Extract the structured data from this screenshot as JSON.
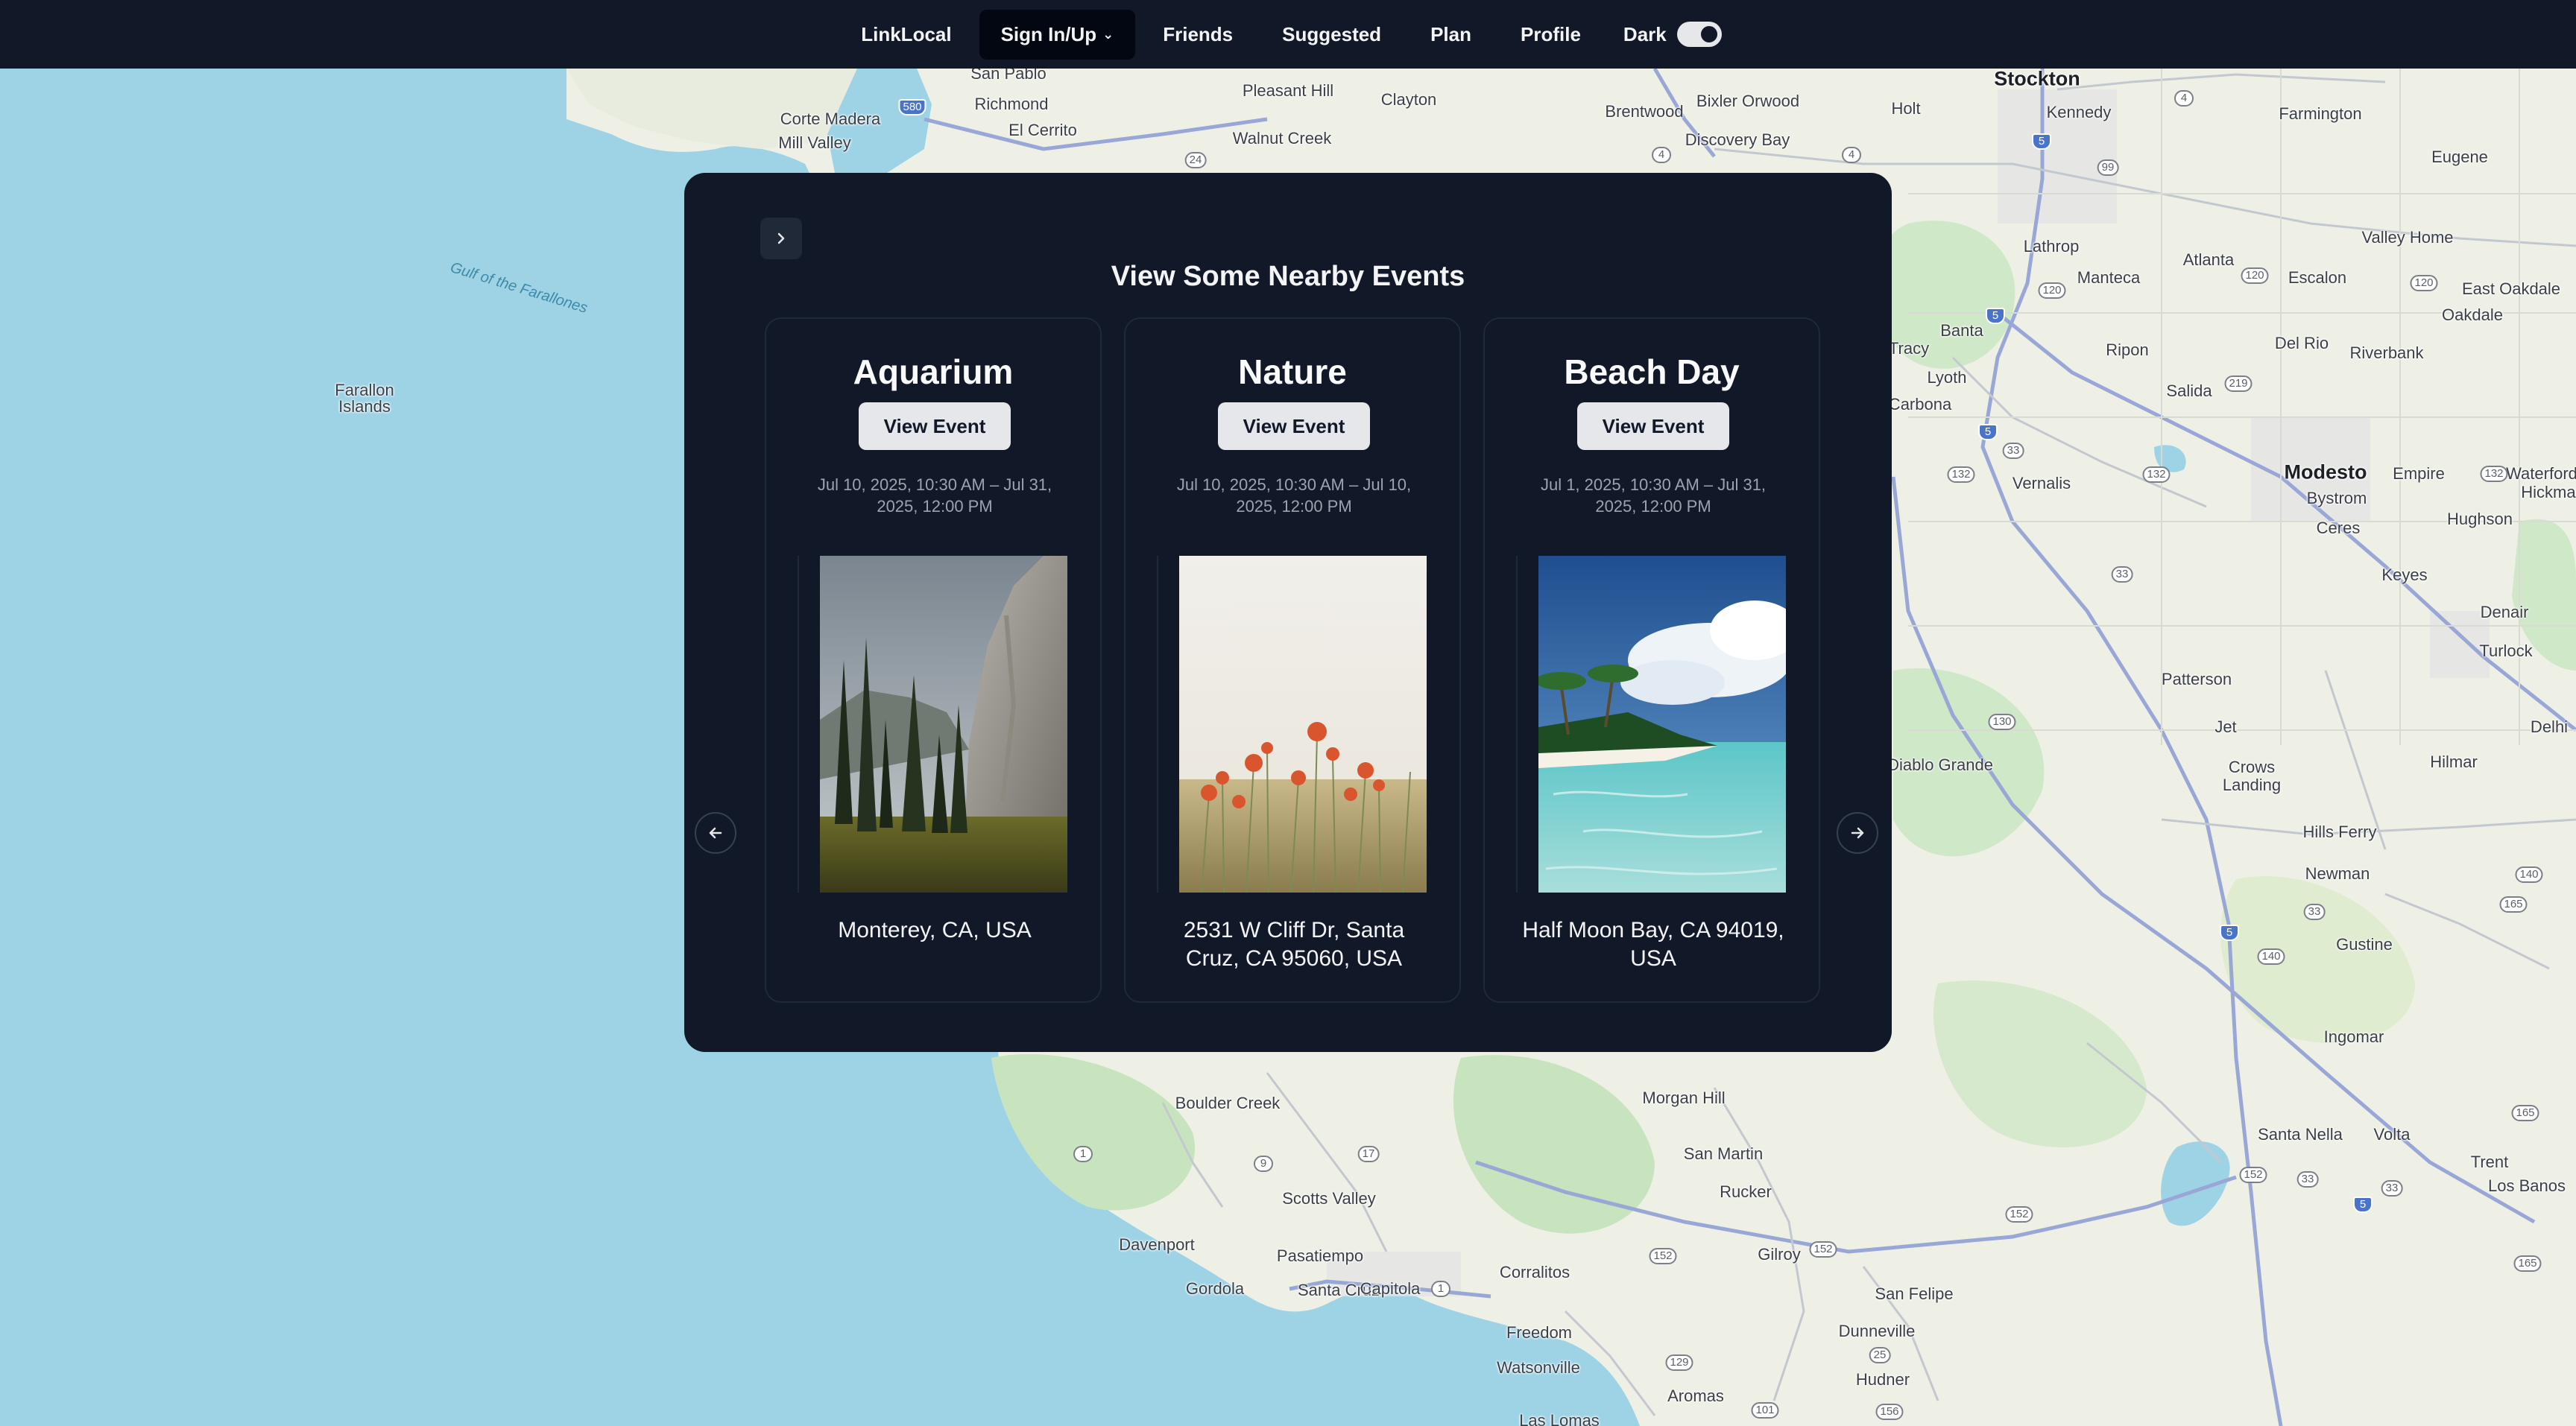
{
  "nav": {
    "items": [
      {
        "label": "LinkLocal",
        "active": false
      },
      {
        "label": "Sign In/Up",
        "active": true,
        "dropdown": true
      },
      {
        "label": "Friends",
        "active": false
      },
      {
        "label": "Suggested",
        "active": false
      },
      {
        "label": "Plan",
        "active": false
      },
      {
        "label": "Profile",
        "active": false
      }
    ],
    "theme_toggle": {
      "label": "Dark",
      "on": true
    }
  },
  "panel": {
    "title": "View Some Nearby Events",
    "collapse_icon": "chevron-right-icon",
    "prev_icon": "arrow-left-icon",
    "next_icon": "arrow-right-icon"
  },
  "events": [
    {
      "title": "Aquarium",
      "button": "View Event",
      "dates": "Jul 10, 2025, 10:30 AM – Jul 31, 2025, 12:00 PM",
      "location": "Monterey, CA, USA",
      "image": "mountain-cliff-forest"
    },
    {
      "title": "Nature",
      "button": "View Event",
      "dates": "Jul 10, 2025, 10:30 AM – Jul 10, 2025, 12:00 PM",
      "location": "2531 W Cliff Dr, Santa Cruz, CA 95060, USA",
      "image": "poppy-meadow"
    },
    {
      "title": "Beach Day",
      "button": "View Event",
      "dates": "Jul 1, 2025, 10:30 AM – Jul 31, 2025, 12:00 PM",
      "location": "Half Moon Bay, CA 94019, USA",
      "image": "tropical-beach"
    }
  ],
  "map": {
    "places": [
      "San Pablo",
      "Richmond",
      "El Cerrito",
      "Corte Madera",
      "Mill Valley",
      "Pleasant Hill",
      "Clayton",
      "Walnut Creek",
      "Brentwood",
      "Bixler Orwood",
      "Discovery Bay",
      "Holt",
      "Stockton",
      "Kennedy",
      "Farmington",
      "Eugene",
      "Lathrop",
      "Atlanta",
      "Manteca",
      "Escalon",
      "Valley Home",
      "East Oakdale",
      "Oakdale",
      "Banta",
      "Tracy",
      "Ripon",
      "Del Rio",
      "Riverbank",
      "Lyoth",
      "Carbona",
      "Salida",
      "Vernalis",
      "Modesto",
      "Bystrom",
      "Empire",
      "Waterford",
      "Hickman",
      "Ceres",
      "Hughson",
      "Keyes",
      "Denair",
      "Turlock",
      "Patterson",
      "Jet",
      "Crows Landing",
      "Diablo Grande",
      "Hilmar",
      "Delhi",
      "Hills Ferry",
      "Newman",
      "Gustine",
      "Ingomar",
      "Santa Nella",
      "Volta",
      "Trent",
      "Los Banos",
      "Gulf of the Farallones",
      "Farallon Islands",
      "Boulder Creek",
      "Morgan Hill",
      "San Martin",
      "Rucker",
      "Scotts Valley",
      "Davenport",
      "Pasatiempo",
      "Gilroy",
      "Corralitos",
      "San Felipe",
      "Gordola",
      "Santa Cruz",
      "Capitola",
      "Freedom",
      "Watsonville",
      "Dunneville",
      "Hudner",
      "Aromas",
      "Las Lomas"
    ],
    "marker": "question-marker"
  }
}
